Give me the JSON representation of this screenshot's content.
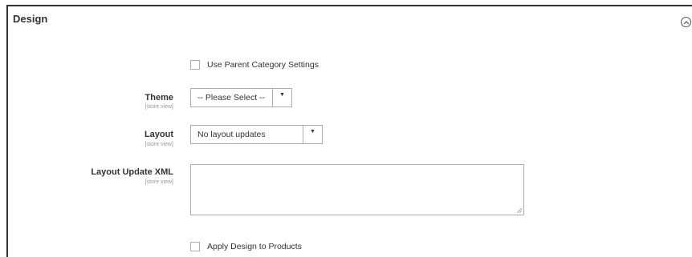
{
  "section": {
    "title": "Design",
    "collapse_icon": "chevron-up-circle-icon"
  },
  "use_parent": {
    "label": "Use Parent Category Settings",
    "checked": false
  },
  "theme": {
    "label": "Theme",
    "scope": "[store view]",
    "value": "-- Please Select --"
  },
  "layout": {
    "label": "Layout",
    "scope": "[store view]",
    "value": "No layout updates"
  },
  "layout_xml": {
    "label": "Layout Update XML",
    "scope": "[store view]",
    "value": ""
  },
  "apply_design": {
    "label": "Apply Design to Products",
    "checked": false
  }
}
